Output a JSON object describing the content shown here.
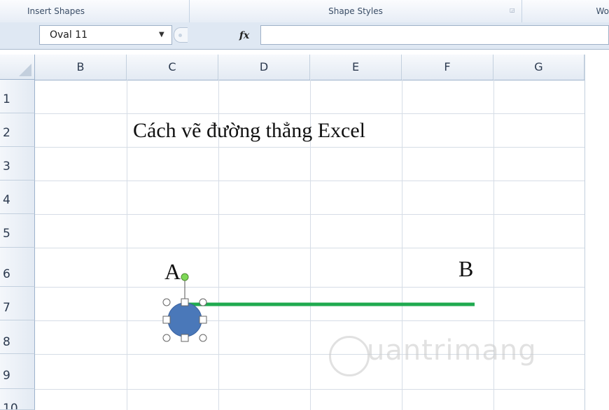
{
  "ribbon": {
    "groups": [
      "Insert Shapes",
      "Shape Styles",
      "Wo"
    ]
  },
  "formula_bar": {
    "name_box": "Oval 11",
    "fx_label": "fx",
    "formula_value": ""
  },
  "sheet": {
    "columns": [
      "B",
      "C",
      "D",
      "E",
      "F",
      "G"
    ],
    "rows": [
      "1",
      "2",
      "3",
      "4",
      "5",
      "6",
      "7",
      "8",
      "9",
      "10"
    ],
    "title_text": "Cách vẽ đường thẳng Excel",
    "label_a": "A",
    "label_b": "B"
  },
  "shapes": {
    "line_color": "#1faa4f",
    "oval_fill": "#4a78b9",
    "rotate_handle_color": "#7ed957"
  },
  "watermark": "uantrimang"
}
